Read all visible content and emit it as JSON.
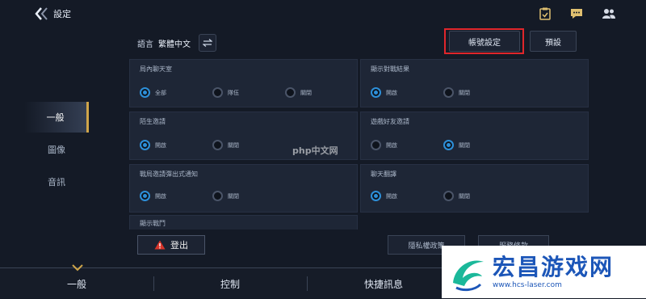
{
  "header": {
    "title": "設定"
  },
  "language": {
    "label": "語言",
    "value": "繁體中文"
  },
  "buttons": {
    "account": "帳號設定",
    "default": "預設"
  },
  "sidebar": {
    "items": [
      {
        "label": "一般"
      },
      {
        "label": "圖像"
      },
      {
        "label": "音訊"
      }
    ]
  },
  "panels": [
    {
      "title": "局內聊天室",
      "options": [
        {
          "label": "全部",
          "on": true
        },
        {
          "label": "隊伍",
          "on": false
        },
        {
          "label": "關閉",
          "on": false
        }
      ]
    },
    {
      "title": "顯示對戰結果",
      "options": [
        {
          "label": "開啟",
          "on": true
        },
        {
          "label": "關閉",
          "on": false
        }
      ]
    },
    {
      "title": "陌生邀請",
      "options": [
        {
          "label": "開啟",
          "on": true
        },
        {
          "label": "關閉",
          "on": false
        }
      ]
    },
    {
      "title": "遊戲好友邀請",
      "options": [
        {
          "label": "開啟",
          "on": false
        },
        {
          "label": "關閉",
          "on": true
        }
      ]
    },
    {
      "title": "戰局邀請彈出式通知",
      "options": [
        {
          "label": "開啟",
          "on": true
        },
        {
          "label": "關閉",
          "on": false
        }
      ]
    },
    {
      "title": "聊天翻譯",
      "options": [
        {
          "label": "開啟",
          "on": true
        },
        {
          "label": "關閉",
          "on": false
        }
      ]
    },
    {
      "title": "顯示戰鬥",
      "options": []
    }
  ],
  "logout": {
    "label": "登出"
  },
  "footer_buttons": {
    "privacy": "隱私權政策",
    "terms": "服務條款"
  },
  "bottom_tabs": [
    {
      "label": "一般"
    },
    {
      "label": "控制"
    },
    {
      "label": "快捷訊息"
    }
  ],
  "watermarks": {
    "php": "php中文网",
    "brand": "宏昌游戏网",
    "url": "www.hcs-laser.com"
  },
  "colors": {
    "accent_gold": "#cfa54a",
    "radio_on": "#2d8fd8",
    "highlight_red": "#e0262b",
    "warning_red": "#d9352a"
  }
}
